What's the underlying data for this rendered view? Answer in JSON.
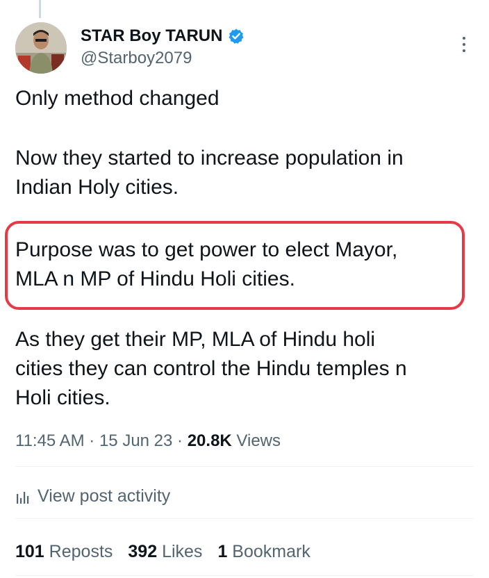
{
  "author": {
    "display_name": "STAR Boy TARUN",
    "handle": "@Starboy2079",
    "verified": true
  },
  "tweet": {
    "paragraphs": [
      [
        "Only method changed"
      ],
      [
        "Now they started to increase population in",
        "Indian Holy cities."
      ],
      [
        "Purpose was to get power to elect Mayor,",
        "MLA n MP of Hindu Holi cities."
      ],
      [
        "As they get their MP, MLA of Hindu holi",
        "cities they can control the Hindu temples n",
        "Holi cities."
      ]
    ]
  },
  "meta": {
    "time": "11:45 AM",
    "separator": " · ",
    "date": "15 Jun 23",
    "views_count": "20.8K",
    "views_label": " Views"
  },
  "activity": {
    "label": "View post activity",
    "icon": "bar-chart-icon"
  },
  "stats": [
    {
      "count": "101",
      "label": "Reposts"
    },
    {
      "count": "392",
      "label": "Likes"
    },
    {
      "count": "1",
      "label": "Bookmark"
    }
  ],
  "colors": {
    "verified": "#1d9bf0",
    "highlight": "#e63946",
    "secondary_text": "#536471",
    "primary_text": "#0f1419"
  }
}
